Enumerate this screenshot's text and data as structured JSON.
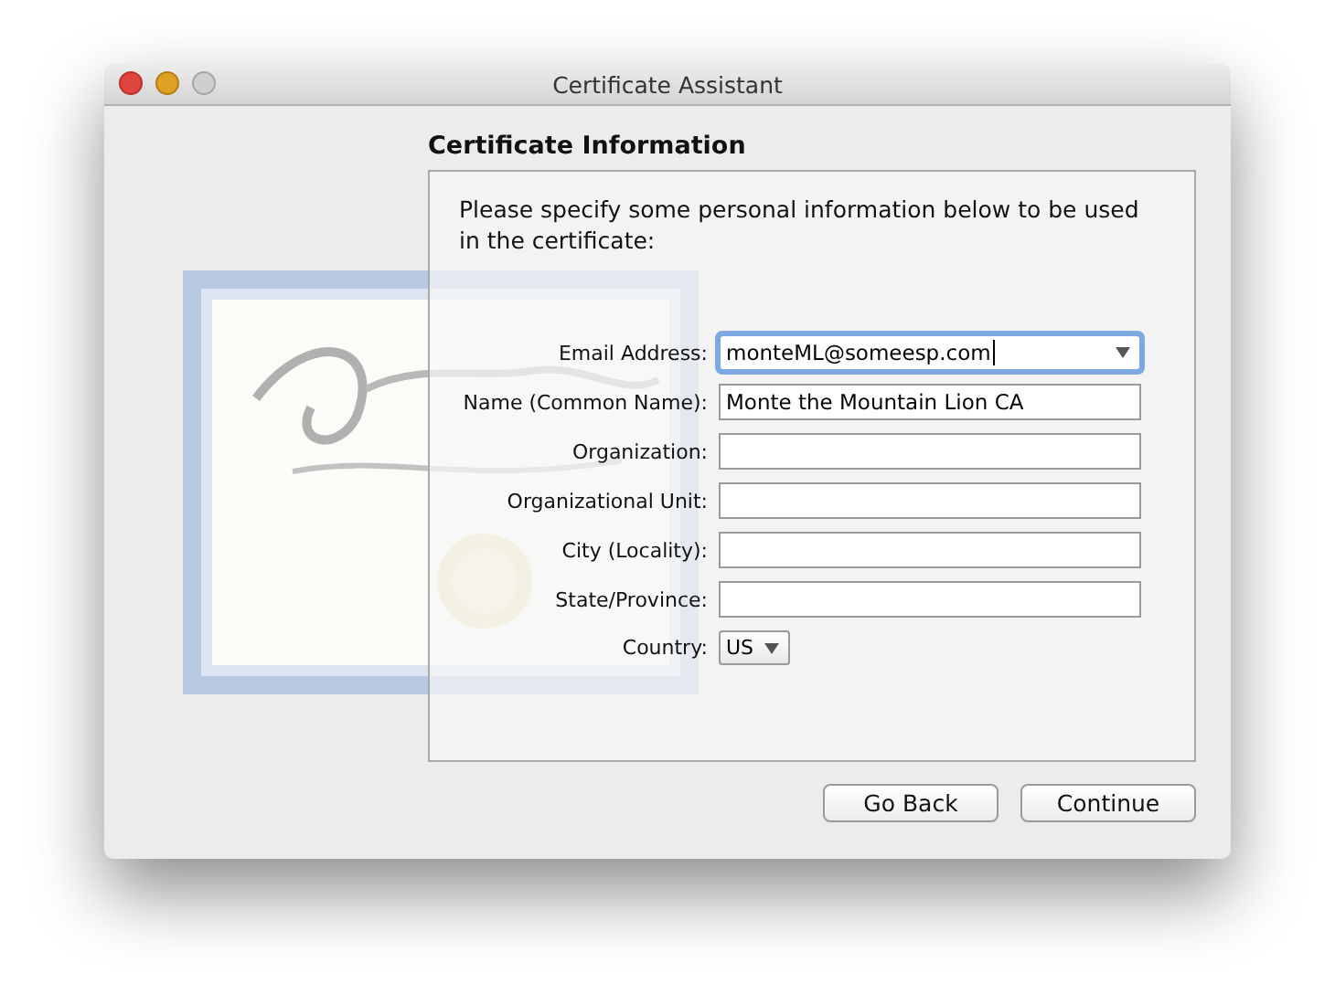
{
  "window": {
    "title": "Certificate Assistant"
  },
  "section": {
    "heading": "Certificate Information",
    "intro": "Please specify some personal information below to be used in the certificate:"
  },
  "fields": [
    {
      "label": "Email Address:",
      "kind": "combo",
      "value": "monteML@someesp.com",
      "focused": true
    },
    {
      "label": "Name (Common Name):",
      "kind": "text",
      "value": "Monte the Mountain Lion CA",
      "focused": false
    },
    {
      "label": "Organization:",
      "kind": "text",
      "focused": false
    },
    {
      "label": "Organizational Unit:",
      "kind": "text",
      "focused": false
    },
    {
      "label": "City (Locality):",
      "kind": "text",
      "focused": false
    },
    {
      "label": "State/Province:",
      "kind": "text",
      "focused": false
    },
    {
      "label": "Country:",
      "kind": "popup",
      "value": "US",
      "focused": false
    }
  ],
  "buttons": [
    {
      "label": "Go Back"
    },
    {
      "label": "Continue"
    }
  ]
}
